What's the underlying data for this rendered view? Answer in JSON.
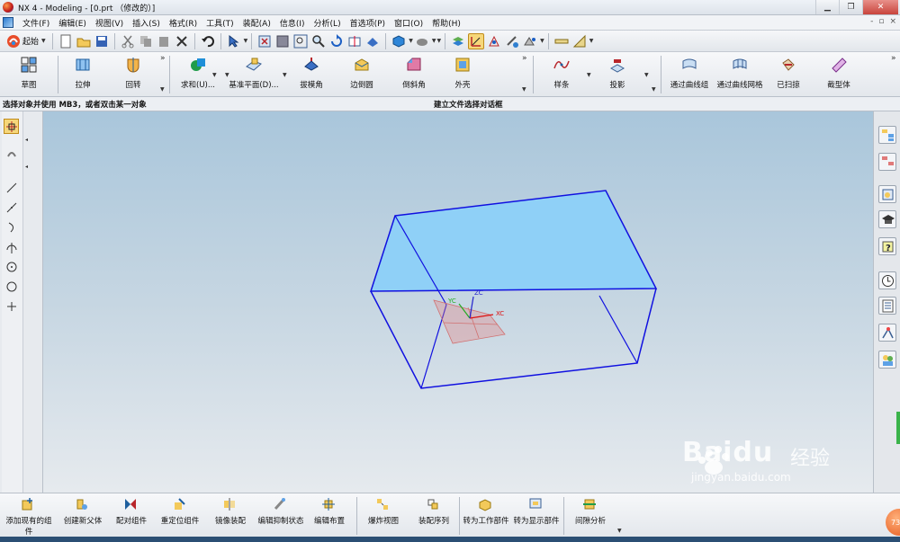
{
  "window": {
    "title": "NX 4 - Modeling - [0.prt （修改的）]",
    "controls": {
      "minimize": "▁",
      "restore": "❐",
      "close": "✕"
    }
  },
  "menubar": {
    "items": [
      "文件(F)",
      "编辑(E)",
      "视图(V)",
      "插入(S)",
      "格式(R)",
      "工具(T)",
      "装配(A)",
      "信息(I)",
      "分析(L)",
      "首选项(P)",
      "窗口(O)",
      "帮助(H)"
    ],
    "right_controls": [
      "-",
      "▫",
      "×"
    ]
  },
  "standard_toolbar": {
    "start_label": "起始",
    "icons": [
      "new-icon",
      "open-icon",
      "save-icon",
      "cut-icon",
      "copy-icon",
      "paste-icon",
      "delete-icon",
      "undo-icon",
      "select-filter-icon",
      "fit-icon",
      "zoom-window-icon",
      "zoom-icon",
      "rotate-icon",
      "pan-icon",
      "view-icon",
      "shaded-icon",
      "render-icon",
      "layer-icon",
      "snap-icon",
      "wcs-icon",
      "measure-icon",
      "analysis-icon",
      "grid-icon",
      "ruler-icon"
    ]
  },
  "feature_toolbar": {
    "groups": [
      {
        "tools": [
          {
            "label": "草图",
            "icon": "sketch-icon"
          }
        ]
      },
      {
        "tools": [
          {
            "label": "拉伸",
            "icon": "extrude-icon"
          },
          {
            "label": "回转",
            "icon": "revolve-icon"
          }
        ]
      },
      {
        "tools": [
          {
            "label": "求和(U)...",
            "icon": "unite-icon"
          },
          {
            "label": "基准平面(D)...",
            "icon": "datum-plane-icon"
          },
          {
            "label": "拔模角",
            "icon": "draft-icon"
          },
          {
            "label": "边倒圆",
            "icon": "edge-blend-icon"
          },
          {
            "label": "倒斜角",
            "icon": "chamfer-icon"
          },
          {
            "label": "外壳",
            "icon": "shell-icon"
          }
        ]
      },
      {
        "tools": [
          {
            "label": "样条",
            "icon": "spline-icon"
          },
          {
            "label": "投影",
            "icon": "project-icon"
          }
        ]
      },
      {
        "tools": [
          {
            "label": "通过曲线组",
            "icon": "through-curves-icon"
          },
          {
            "label": "通过曲线网格",
            "icon": "curve-mesh-icon"
          },
          {
            "label": "已扫掠",
            "icon": "swept-icon"
          },
          {
            "label": "截型体",
            "icon": "section-body-icon"
          }
        ]
      }
    ]
  },
  "cue_line": {
    "prompt": "选择对象并使用 MB3，或者双击某一对象",
    "status": "建立文件选择对话框"
  },
  "viewport": {
    "model": "rectangular block, top face highlighted",
    "highlight_color": "#8fd0f7",
    "edge_color": "#1010e0",
    "wcs_labels": {
      "x": "XC",
      "y": "YC",
      "z": "ZC"
    }
  },
  "watermark": {
    "brand": "Bai",
    "brand2": "du",
    "chinese": "经验",
    "url": "jingyan.baidu.com"
  },
  "assembly_toolbar": {
    "tools": [
      {
        "label": "添加现有的组件",
        "icon": "add-component-icon"
      },
      {
        "label": "创建新父体",
        "icon": "new-parent-icon"
      },
      {
        "label": "配对组件",
        "icon": "mate-component-icon"
      },
      {
        "label": "重定位组件",
        "icon": "reposition-component-icon"
      },
      {
        "label": "镜像装配",
        "icon": "mirror-assembly-icon"
      },
      {
        "label": "编辑抑制状态",
        "icon": "edit-suppression-icon"
      },
      {
        "label": "编辑布置",
        "icon": "edit-arrangement-icon"
      },
      {
        "label": "爆炸视图",
        "icon": "exploded-view-icon"
      },
      {
        "label": "装配序列",
        "icon": "assembly-sequence-icon"
      },
      {
        "label": "转为工作部件",
        "icon": "make-work-part-icon"
      },
      {
        "label": "转为显示部件",
        "icon": "make-displayed-part-icon"
      },
      {
        "label": "间隙分析",
        "icon": "clearance-analysis-icon"
      }
    ]
  },
  "badge": {
    "value": "73"
  }
}
